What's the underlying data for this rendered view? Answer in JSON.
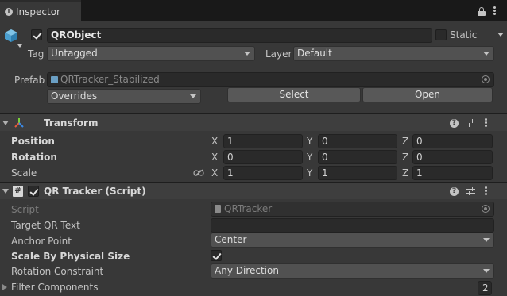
{
  "tab": {
    "title": "Inspector",
    "icon": "info-icon"
  },
  "window_controls": [
    "lock-icon",
    "menu-icon"
  ],
  "object": {
    "active": true,
    "name": "QRObject",
    "static_label": "Static",
    "static_checked": false,
    "tag_label": "Tag",
    "tag_value": "Untagged",
    "layer_label": "Layer",
    "layer_value": "Default",
    "prefab_label": "Prefab",
    "prefab_value": "QRTracker_Stabilized",
    "overrides_value": "Overrides",
    "select_label": "Select",
    "open_label": "Open"
  },
  "transform": {
    "title": "Transform",
    "position": {
      "label": "Position",
      "x": "1",
      "y": "0",
      "z": "0"
    },
    "rotation": {
      "label": "Rotation",
      "x": "0",
      "y": "0",
      "z": "0"
    },
    "scale": {
      "label": "Scale",
      "x": "1",
      "y": "1",
      "z": "1"
    },
    "axis": {
      "x": "X",
      "y": "Y",
      "z": "Z"
    }
  },
  "qr_tracker": {
    "title": "QR Tracker (Script)",
    "enabled": true,
    "script_label": "Script",
    "script_value": "QRTracker",
    "target_text_label": "Target QR Text",
    "target_text_value": "",
    "anchor_label": "Anchor Point",
    "anchor_value": "Center",
    "scale_physical_label": "Scale By Physical Size",
    "scale_physical_checked": true,
    "rotation_constraint_label": "Rotation Constraint",
    "rotation_constraint_value": "Any Direction",
    "filter_label": "Filter Components",
    "filter_count": "2"
  },
  "colors": {
    "background": "#383838",
    "field": "#2a2a2a",
    "header": "#3e3e3e",
    "tab_bar": "#191919"
  }
}
